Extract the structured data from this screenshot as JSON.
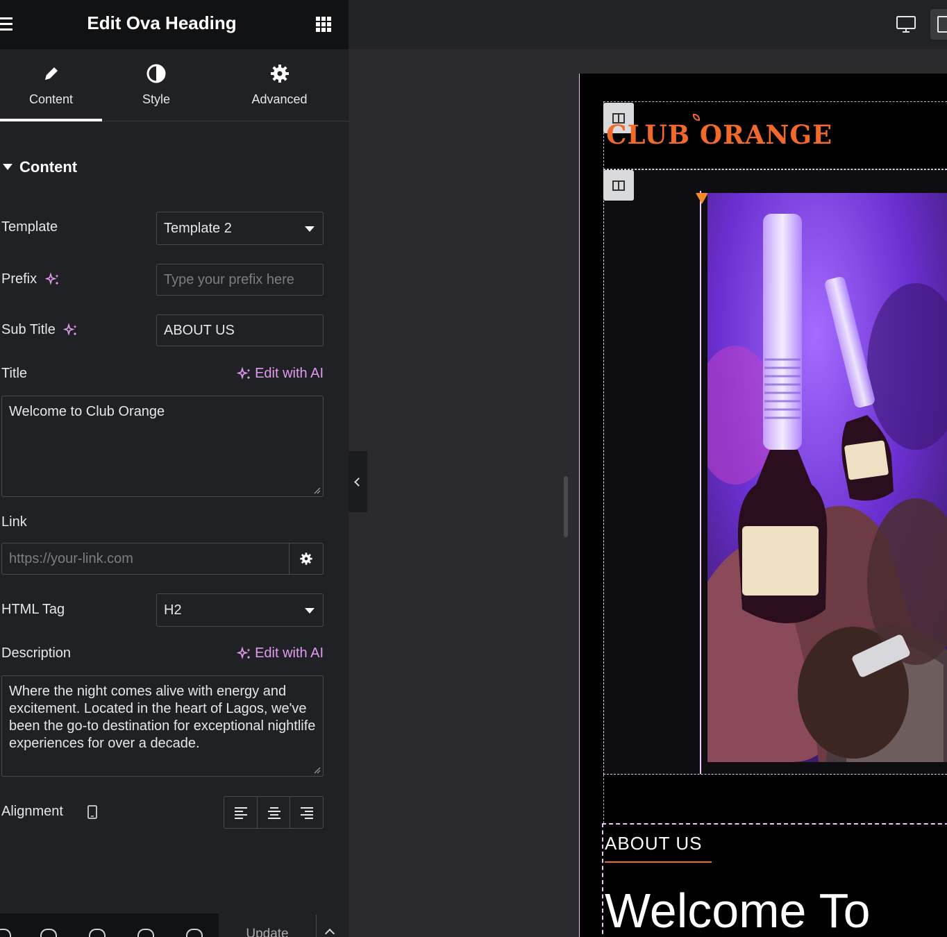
{
  "panel": {
    "title": "Edit Ova Heading",
    "tabs": [
      {
        "label": "Content"
      },
      {
        "label": "Style"
      },
      {
        "label": "Advanced"
      }
    ],
    "section_title": "Content",
    "fields": {
      "template": {
        "label": "Template",
        "value": "Template 2"
      },
      "prefix": {
        "label": "Prefix",
        "placeholder": "Type your prefix here"
      },
      "subtitle": {
        "label": "Sub Title",
        "value": "ABOUT US"
      },
      "title": {
        "label": "Title",
        "ai_label": "Edit with AI",
        "value": "Welcome to Club Orange"
      },
      "link": {
        "label": "Link",
        "placeholder": "https://your-link.com"
      },
      "html_tag": {
        "label": "HTML Tag",
        "value": "H2"
      },
      "description": {
        "label": "Description",
        "ai_label": "Edit with AI",
        "value": "Where the night comes alive with energy and excitement. Located in the heart of Lagos, we've been the go-to destination for exceptional nightlife experiences for over a decade."
      },
      "alignment": {
        "label": "Alignment"
      }
    },
    "footer": {
      "update_label": "Update"
    }
  },
  "canvas": {
    "logo_text": "CLUB ORANGE",
    "heading_sub": "ABOUT US",
    "heading_title": "Welcome To"
  },
  "colors": {
    "accent_ai": "#e29bf0",
    "brand_orange": "#f16a2b",
    "panel_bg": "#202124"
  }
}
